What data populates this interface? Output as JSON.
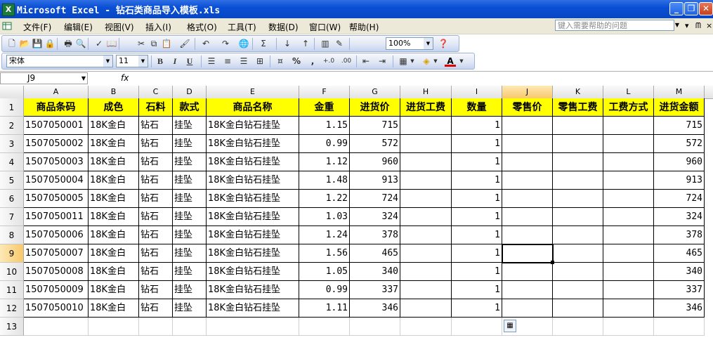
{
  "window": {
    "title": "Microsoft Excel - 钻石类商品导入模板.xls",
    "app_icon": "excel-icon",
    "minimize_label": "_",
    "restore_label": "❐",
    "close_label": "✕"
  },
  "menubar": {
    "items": [
      {
        "label": "文件(F)"
      },
      {
        "label": "编辑(E)"
      },
      {
        "label": "视图(V)"
      },
      {
        "label": "插入(I)"
      },
      {
        "label": "格式(O)"
      },
      {
        "label": "工具(T)"
      },
      {
        "label": "数据(D)"
      },
      {
        "label": "窗口(W)"
      },
      {
        "label": "帮助(H)"
      }
    ],
    "help_placeholder": "键入需要帮助的问题",
    "mdi_minimize": "▾",
    "mdi_restore": "ᗰ",
    "mdi_close": "×"
  },
  "standard_toolbar": {
    "zoom": "100%",
    "icons": [
      "new-icon",
      "open-icon",
      "save-icon",
      "permission-icon",
      "print-icon",
      "print-preview-icon",
      "spelling-icon",
      "research-icon",
      "cut-icon",
      "copy-icon",
      "paste-icon",
      "format-painter-icon",
      "undo-icon",
      "redo-icon",
      "hyperlink-icon",
      "autosum-icon",
      "sort-ascending-icon",
      "sort-descending-icon",
      "chart-wizard-icon",
      "drawing-icon",
      "help-icon"
    ]
  },
  "formatting_toolbar": {
    "font": "宋体",
    "font_size": "11",
    "bold": "B",
    "italic": "I",
    "underline": "U",
    "percent": "%",
    "comma": ",",
    "increase_decimal": "+.0",
    "decrease_decimal": ".00",
    "font_color_label": "A"
  },
  "formula_bar": {
    "name_box": "J9",
    "fx": "fx",
    "formula": ""
  },
  "sheet": {
    "columns": [
      "A",
      "B",
      "C",
      "D",
      "E",
      "F",
      "G",
      "H",
      "I",
      "J",
      "K",
      "L",
      "M"
    ],
    "selected_column": "J",
    "selected_row": "9",
    "row_numbers": [
      "1",
      "2",
      "3",
      "4",
      "5",
      "6",
      "7",
      "8",
      "9",
      "10",
      "11",
      "12",
      "13"
    ],
    "header_row": [
      "商品条码",
      "成色",
      "石料",
      "款式",
      "商品名称",
      "金重",
      "进货价",
      "进货工费",
      "数量",
      "零售价",
      "零售工费",
      "工费方式",
      "进货金额"
    ],
    "rows": [
      [
        "1507050001",
        "18K金白",
        "钻石",
        "挂坠",
        "18K金白钻石挂坠",
        "1.15",
        "715",
        "",
        "1",
        "",
        "",
        "",
        "715"
      ],
      [
        "1507050002",
        "18K金白",
        "钻石",
        "挂坠",
        "18K金白钻石挂坠",
        "0.99",
        "572",
        "",
        "1",
        "",
        "",
        "",
        "572"
      ],
      [
        "1507050003",
        "18K金白",
        "钻石",
        "挂坠",
        "18K金白钻石挂坠",
        "1.12",
        "960",
        "",
        "1",
        "",
        "",
        "",
        "960"
      ],
      [
        "1507050004",
        "18K金白",
        "钻石",
        "挂坠",
        "18K金白钻石挂坠",
        "1.48",
        "913",
        "",
        "1",
        "",
        "",
        "",
        "913"
      ],
      [
        "1507050005",
        "18K金白",
        "钻石",
        "挂坠",
        "18K金白钻石挂坠",
        "1.22",
        "724",
        "",
        "1",
        "",
        "",
        "",
        "724"
      ],
      [
        "1507050011",
        "18K金白",
        "钻石",
        "挂坠",
        "18K金白钻石挂坠",
        "1.03",
        "324",
        "",
        "1",
        "",
        "",
        "",
        "324"
      ],
      [
        "1507050006",
        "18K金白",
        "钻石",
        "挂坠",
        "18K金白钻石挂坠",
        "1.24",
        "378",
        "",
        "1",
        "",
        "",
        "",
        "378"
      ],
      [
        "1507050007",
        "18K金白",
        "钻石",
        "挂坠",
        "18K金白钻石挂坠",
        "1.56",
        "465",
        "",
        "1",
        "",
        "",
        "",
        "465"
      ],
      [
        "1507050008",
        "18K金白",
        "钻石",
        "挂坠",
        "18K金白钻石挂坠",
        "1.05",
        "340",
        "",
        "1",
        "",
        "",
        "",
        "340"
      ],
      [
        "1507050009",
        "18K金白",
        "钻石",
        "挂坠",
        "18K金白钻石挂坠",
        "0.99",
        "337",
        "",
        "1",
        "",
        "",
        "",
        "337"
      ],
      [
        "1507050010",
        "18K金白",
        "钻石",
        "挂坠",
        "18K金白钻石挂坠",
        "1.11",
        "346",
        "",
        "1",
        "",
        "",
        "",
        "346"
      ]
    ],
    "header_fill": "#ffff00",
    "selection_fill": "#f9c86a"
  }
}
